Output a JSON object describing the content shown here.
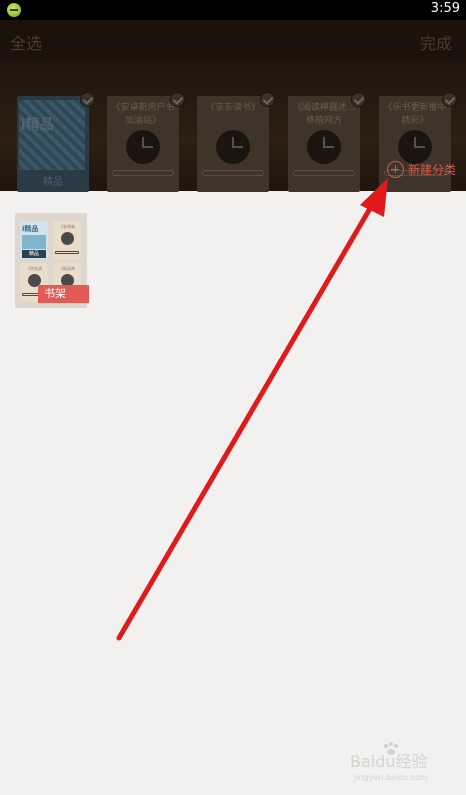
{
  "status_bar": {
    "time": "3:59"
  },
  "toolbar": {
    "select_all_label": "全选",
    "done_label": "完成"
  },
  "shelf": {
    "books": [
      {
        "type": "cover",
        "brand": "i精品",
        "label": "精品"
      },
      {
        "type": "placeholder",
        "title": "《安卓新用户书加油站》"
      },
      {
        "type": "placeholder",
        "title": "《京东读书》"
      },
      {
        "type": "placeholder",
        "title": "《阅读神器述...移植网方"
      },
      {
        "type": "placeholder",
        "title": "《乐书更新推中精彩》"
      }
    ],
    "new_category_label": "新建分类"
  },
  "folder": {
    "label": "书架",
    "mini_books": [
      {
        "type": "cover",
        "brand": "i精品",
        "label": "精品"
      },
      {
        "type": "placeholder",
        "title": "《安卓新"
      },
      {
        "type": "placeholder",
        "title": "《京东读"
      },
      {
        "type": "placeholder",
        "title": "《阅读神"
      }
    ]
  },
  "watermark": {
    "text": "Baidu经验",
    "sub": "jingyan.baidu.com"
  },
  "colors": {
    "accent": "#e15a53",
    "arrow": "#e01a1a",
    "background": "#f2f1ef"
  }
}
